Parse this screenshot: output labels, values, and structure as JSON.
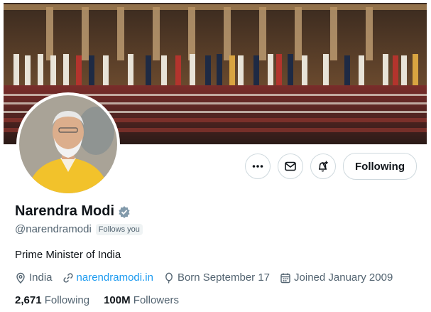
{
  "profile": {
    "name": "Narendra Modi",
    "handle": "@narendramodi",
    "follows_you": "Follows you",
    "bio": "Prime Minister of India",
    "verified": true
  },
  "actions": {
    "more_icon": "more-icon",
    "message_icon": "message-icon",
    "notify_icon": "bell-plus-icon",
    "following_label": "Following"
  },
  "meta": {
    "location": "India",
    "website": "narendramodi.in",
    "born": "Born September 17",
    "joined": "Joined January 2009"
  },
  "stats": {
    "following_count": "2,671",
    "following_label": "Following",
    "followers_count": "100M",
    "followers_label": "Followers"
  },
  "colors": {
    "accent": "#1d9bf0",
    "muted_text": "#536471",
    "border": "#cfd9de",
    "verified_badge": "#829aab"
  }
}
